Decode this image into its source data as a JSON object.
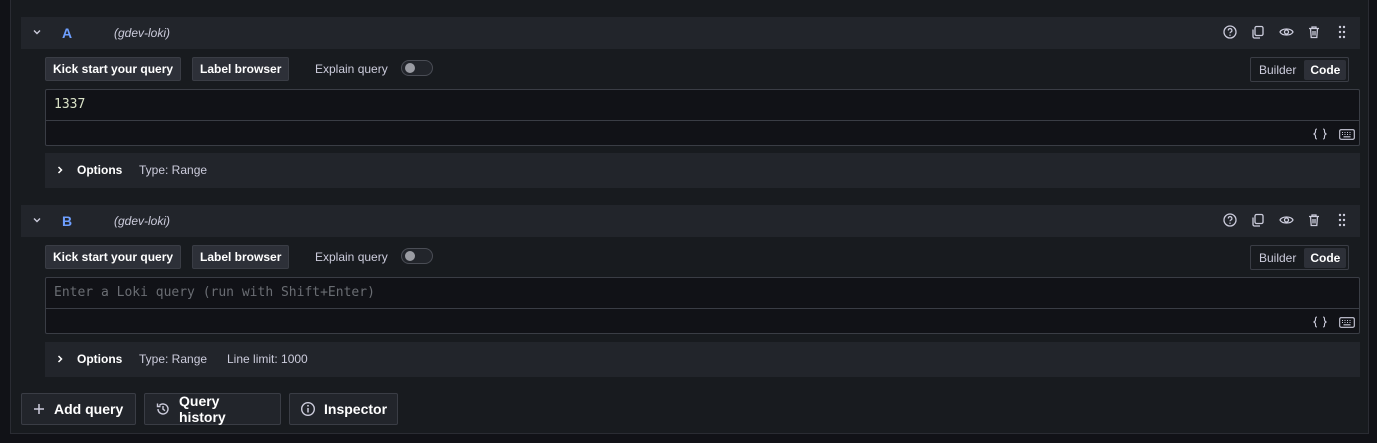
{
  "queries": [
    {
      "ref": "A",
      "datasource": "(gdev-loki)",
      "kick_start_label": "Kick start your query",
      "label_browser_label": "Label browser",
      "explain_label": "Explain query",
      "explain_enabled": false,
      "mode_options": [
        "Builder",
        "Code"
      ],
      "mode_selected": "Code",
      "editor_value": "1337",
      "editor_placeholder": "",
      "options_label": "Options",
      "options_type": "Type: Range",
      "options_limit": ""
    },
    {
      "ref": "B",
      "datasource": "(gdev-loki)",
      "kick_start_label": "Kick start your query",
      "label_browser_label": "Label browser",
      "explain_label": "Explain query",
      "explain_enabled": false,
      "mode_options": [
        "Builder",
        "Code"
      ],
      "mode_selected": "Code",
      "editor_value": "",
      "editor_placeholder": "Enter a Loki query (run with Shift+Enter)",
      "options_label": "Options",
      "options_type": "Type: Range",
      "options_limit": "Line limit: 1000"
    }
  ],
  "footer": {
    "add_query_label": "Add query",
    "query_history_label": "Query history",
    "inspector_label": "Inspector"
  },
  "icons": {
    "collapse": "chevron-down-icon",
    "help": "question-circle-icon",
    "duplicate": "copy-icon",
    "visibility": "eye-icon",
    "delete": "trash-icon",
    "drag": "drag-handle-icon",
    "format": "braces-icon",
    "keyboard": "keyboard-icon",
    "expand": "chevron-right-icon",
    "add": "plus-icon",
    "history": "history-icon",
    "info": "info-circle-icon"
  },
  "colors": {
    "accent": "#6e9fff",
    "background": "#111217",
    "panel": "#181b1f",
    "header": "#22252b"
  }
}
